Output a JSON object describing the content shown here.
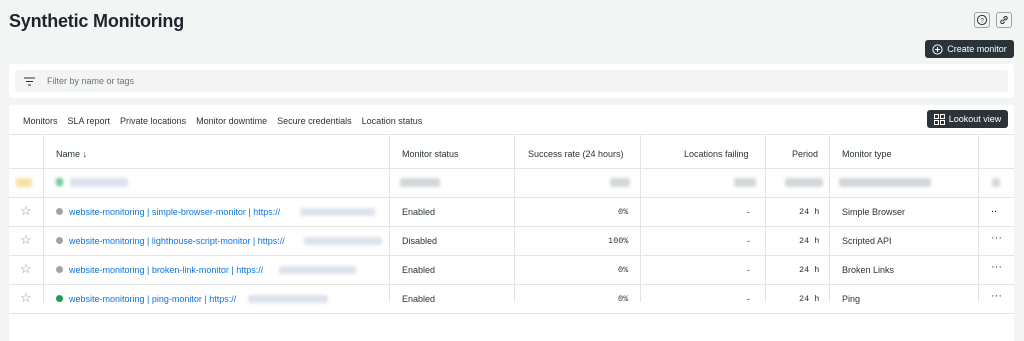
{
  "header": {
    "title": "Synthetic Monitoring",
    "create_label": "Create monitor"
  },
  "filter": {
    "placeholder": "Filter by name or tags"
  },
  "tabs": [
    {
      "label": "Monitors"
    },
    {
      "label": "SLA report"
    },
    {
      "label": "Private locations"
    },
    {
      "label": "Monitor downtime"
    },
    {
      "label": "Secure credentials"
    },
    {
      "label": "Location status"
    }
  ],
  "lookout_label": "Lookout view",
  "table": {
    "columns": {
      "name": "Name ↓",
      "status": "Monitor status",
      "success": "Success rate (24 hours)",
      "failing": "Locations failing",
      "period": "Period",
      "type": "Monitor type"
    },
    "rows": [
      {
        "name": "website-monitoring | simple-browser-monitor | https://",
        "status": "Enabled",
        "success": "0%",
        "failing": "-",
        "period": "24 h",
        "type": "Simple Browser",
        "more": "..",
        "dot_color": "#9ea5a9"
      },
      {
        "name": "website-monitoring | lighthouse-script-monitor | https://",
        "status": "Disabled",
        "success": "100%",
        "failing": "-",
        "period": "24 h",
        "type": "Scripted API",
        "more": "···",
        "dot_color": "#9ea5a9"
      },
      {
        "name": "website-monitoring | broken-link-monitor | https://",
        "status": "Enabled",
        "success": "0%",
        "failing": "-",
        "period": "24 h",
        "type": "Broken Links",
        "more": "···",
        "dot_color": "#9ea5a9"
      },
      {
        "name": "website-monitoring | ping-monitor | https://",
        "status": "Enabled",
        "success": "0%",
        "failing": "-",
        "period": "24 h",
        "type": "Ping",
        "more": "···",
        "dot_color": "#1aa056"
      }
    ]
  }
}
